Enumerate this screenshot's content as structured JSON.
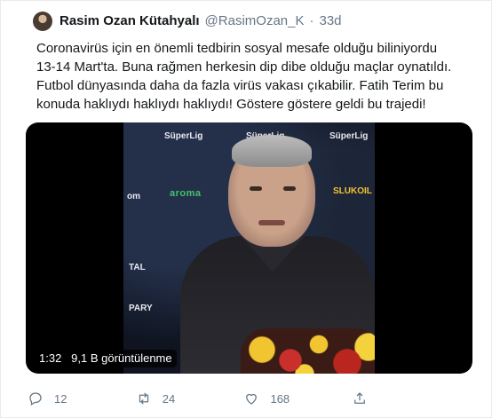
{
  "tweet": {
    "display_name": "Rasim Ozan Kütahyalı",
    "handle": "@RasimOzan_K",
    "separator": "·",
    "age": "33d",
    "text": "Coronavirüs için en önemli tedbirin sosyal mesafe olduğu biliniyordu 13-14 Mart'ta. Buna rağmen herkesin dip dibe olduğu maçlar oynatıldı. Futbol dünyasında daha da fazla virüs vakası çıkabilir. Fatih Terim bu konuda haklıydı haklıydı haklıydı! Göstere göstere geldi bu trajedi!"
  },
  "video": {
    "duration": "1:32",
    "views": "9,1 B görüntülenme",
    "sponsors": [
      "SüperLig",
      "SüperLig",
      "SüperLig",
      "aroma",
      "SLUKOIL",
      "PARY",
      "TAL",
      "om"
    ]
  },
  "actions": {
    "reply_count": "12",
    "retweet_count": "24",
    "like_count": "168"
  },
  "colors": {
    "text": "#14171a",
    "secondary": "#657786",
    "background": "#e6ecf0"
  }
}
